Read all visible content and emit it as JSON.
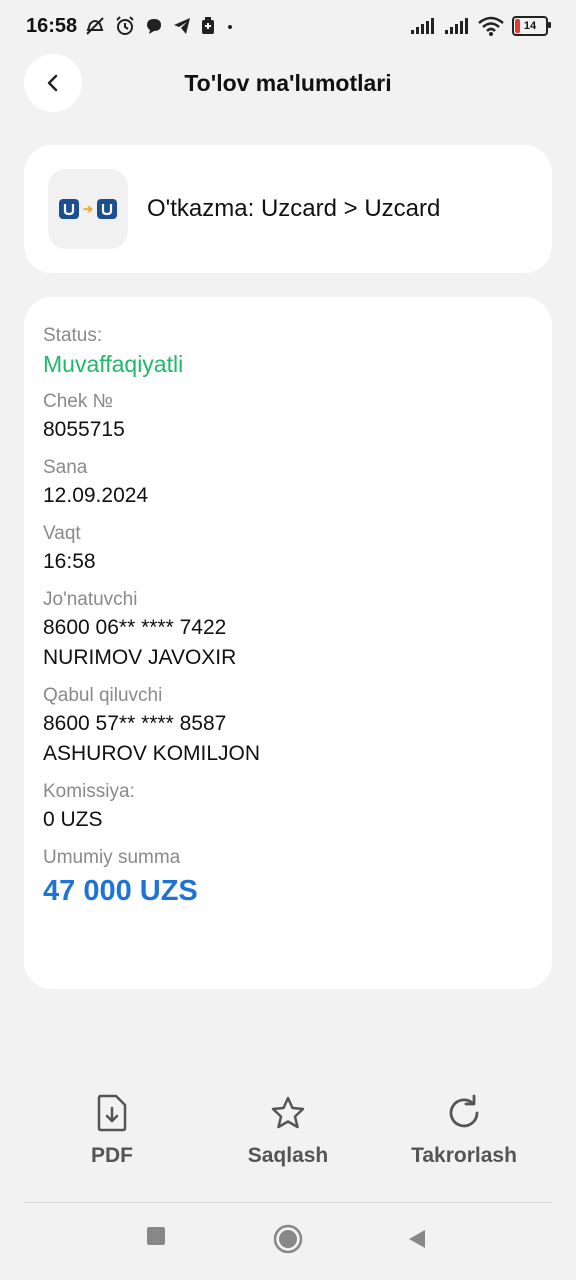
{
  "status_bar": {
    "time": "16:58",
    "battery": "14",
    "icons_left": [
      "mute-icon",
      "alarm-icon",
      "chat-icon",
      "telegram-icon",
      "battery-saver-icon",
      "dot-icon"
    ],
    "icons_right": [
      "signal-icon",
      "signal-icon",
      "wifi-icon",
      "battery-icon"
    ]
  },
  "header": {
    "title": "To'lov ma'lumotlari"
  },
  "transfer": {
    "title": "O'tkazma: Uzcard > Uzcard"
  },
  "details": {
    "status_label": "Status:",
    "status_value": "Muvaffaqiyatli",
    "receipt_label": "Chek №",
    "receipt_value": "8055715",
    "date_label": "Sana",
    "date_value": "12.09.2024",
    "time_label": "Vaqt",
    "time_value": "16:58",
    "sender_label": "Jo'natuvchi",
    "sender_card": "8600 06** **** 7422",
    "sender_name": "NURIMOV JAVOXIR",
    "receiver_label": "Qabul qiluvchi",
    "receiver_card": "8600 57** **** 8587",
    "receiver_name": "ASHUROV KOMILJON",
    "fee_label": "Komissiya:",
    "fee_value": "0 UZS",
    "total_label": "Umumiy summa",
    "total_value": "47 000 UZS"
  },
  "actions": {
    "pdf_label": "PDF",
    "save_label": "Saqlash",
    "repeat_label": "Takrorlash"
  },
  "colors": {
    "success": "#1fb86b",
    "accent": "#1e73d8",
    "background": "#f2f2f2"
  }
}
